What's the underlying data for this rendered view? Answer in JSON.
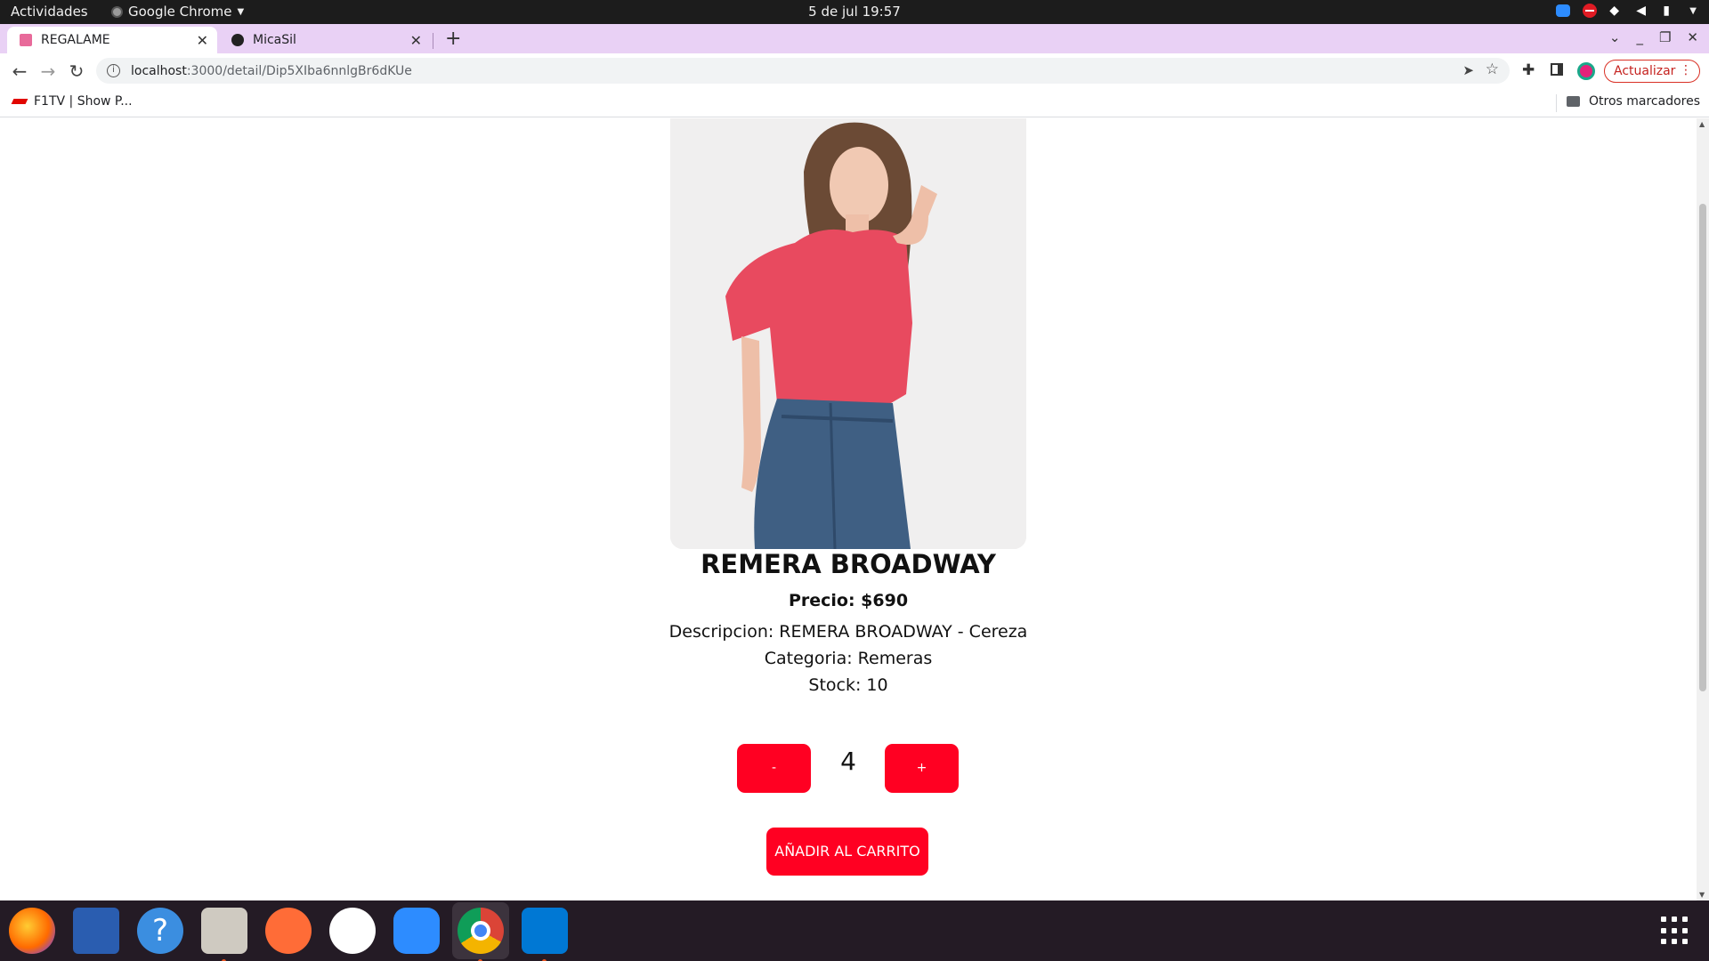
{
  "system_bar": {
    "activities": "Actividades",
    "app_name": "Google Chrome",
    "clock": "5 de jul  19:57"
  },
  "tabs": [
    {
      "title": "REGALAME",
      "active": true
    },
    {
      "title": "MicaSil",
      "active": false
    }
  ],
  "toolbar": {
    "url_host": "localhost",
    "url_path": ":3000/detail/Dip5XIba6nnlgBr6dKUe",
    "update_label": "Actualizar"
  },
  "bookmarks": {
    "items": [
      {
        "label": "F1TV | Show P..."
      }
    ],
    "other_label": "Otros marcadores"
  },
  "product": {
    "title": "REMERA BROADWAY",
    "price": "Precio: $690",
    "description": "Descripcion: REMERA BROADWAY - Cereza",
    "category": "Categoria: Remeras",
    "stock": "Stock: 10",
    "quantity": "4",
    "minus_label": "-",
    "plus_label": "+",
    "add_to_cart_label": "AÑADIR AL CARRITO"
  },
  "dock": {
    "apps": [
      "firefox-icon",
      "libreoffice-writer-icon",
      "help-icon",
      "files-icon",
      "postman-icon",
      "slack-icon",
      "zoom-icon",
      "chrome-icon",
      "vscode-icon"
    ],
    "help_glyph": "?"
  },
  "colors": {
    "accent_red": "#ff0022",
    "tabstrip": "#e9d1f5",
    "dock": "#241b25"
  }
}
